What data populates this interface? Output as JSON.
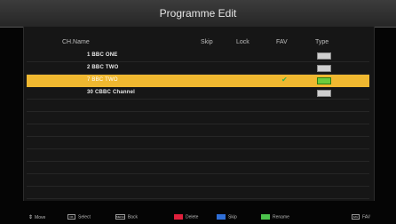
{
  "title": "Programme Edit",
  "columns": {
    "name": "CH.Name",
    "skip": "Skip",
    "lock": "Lock",
    "fav": "FAV",
    "type": "Type"
  },
  "rows": [
    {
      "name": "1 BBC ONE",
      "selected": false,
      "fav": false,
      "type_icon": "tv-icon"
    },
    {
      "name": "2 BBC TWO",
      "selected": false,
      "fav": false,
      "type_icon": "tv-icon"
    },
    {
      "name": "7 BBC TWO",
      "selected": true,
      "fav": true,
      "type_icon": "tv-icon"
    },
    {
      "name": "30 CBBC Channel",
      "selected": false,
      "fav": false,
      "type_icon": "tv-icon"
    }
  ],
  "empty_rows": 8,
  "fav_icon": "checkmark-icon",
  "footer": {
    "move": "Move",
    "select": "Select",
    "back": "Back",
    "delete": "Delete",
    "skip": "Skip",
    "rename": "Rename",
    "fav": "FAV"
  },
  "colors": {
    "selected_row": "#f0b830",
    "delete_key": "#e0203c",
    "skip_key": "#2f6fd8",
    "rename_key": "#4cc34c"
  }
}
